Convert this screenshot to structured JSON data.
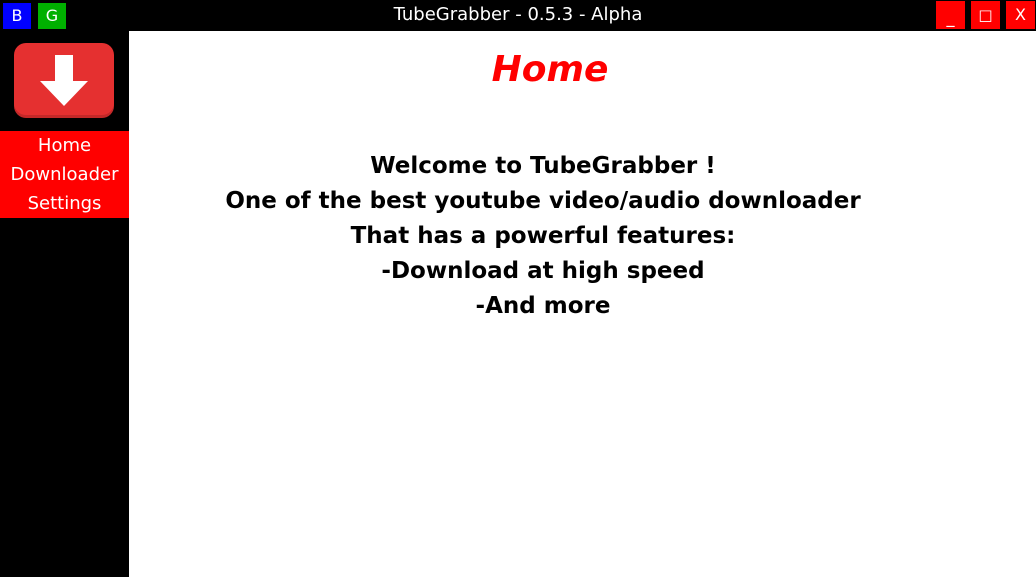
{
  "window": {
    "title": "TubeGrabber - 0.5.3 - Alpha",
    "controls": {
      "minimize": "_",
      "maximize": "□",
      "close": "X"
    }
  },
  "theme_buttons": [
    {
      "label": "B",
      "color": "#0000ff"
    },
    {
      "label": "G",
      "color": "#00b000"
    }
  ],
  "sidebar": {
    "logo_icon": "download-arrow-icon",
    "accent": "#ff0000",
    "items": [
      {
        "label": "Home"
      },
      {
        "label": "Downloader"
      },
      {
        "label": "Settings"
      }
    ]
  },
  "main": {
    "title": "Home",
    "title_color": "#ff0000",
    "lines": [
      "Welcome to TubeGrabber !",
      "One of the best youtube video/audio downloader",
      "That has a powerful features:",
      "-Download at high speed",
      "-And more"
    ]
  }
}
